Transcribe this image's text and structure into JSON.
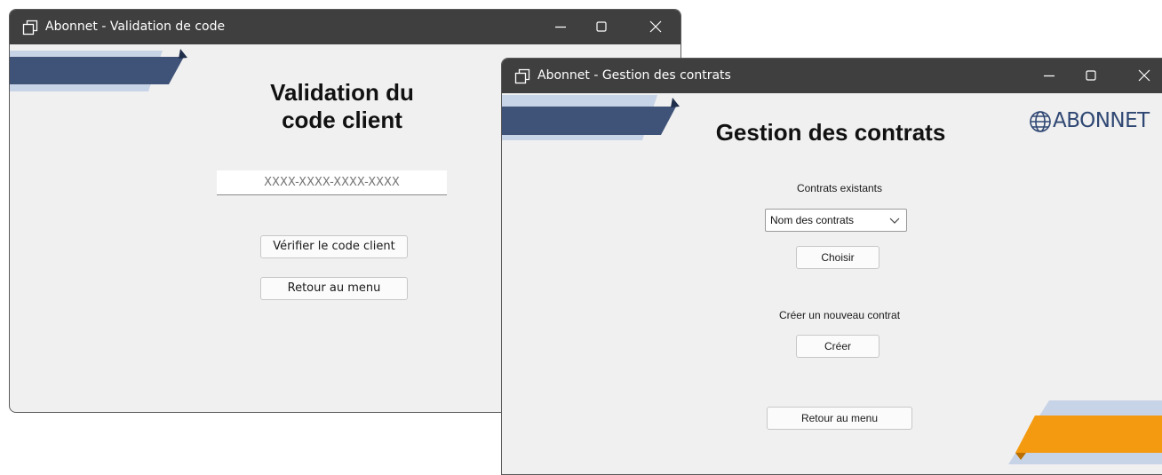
{
  "windows": {
    "validation": {
      "title": "Abonnet - Validation de code",
      "heading_line1": "Validation du",
      "heading_line2": "code client",
      "code_placeholder": "XXXX-XXXX-XXXX-XXXX",
      "verify_label": "Vérifier le code client",
      "back_label": "Retour au menu"
    },
    "contracts": {
      "title": "Abonnet - Gestion des contrats",
      "heading": "Gestion des contrats",
      "logo_text": "ABONNET",
      "existing_label": "Contrats existants",
      "contract_select_value": "Nom des contrats",
      "choose_label": "Choisir",
      "new_label": "Créer un nouveau contrat",
      "create_label": "Créer",
      "back_label": "Retour au menu"
    }
  },
  "colors": {
    "titlebar": "#3f3f3f",
    "window_bg": "#f0f0f0",
    "ribbon_dark": "#3f5277",
    "ribbon_light": "#c7d3e6",
    "ribbon_orange": "#f39a11"
  },
  "icons": [
    "app-window-icon",
    "minimize-icon",
    "maximize-icon",
    "close-icon",
    "chevron-down-icon",
    "globe-icon"
  ]
}
